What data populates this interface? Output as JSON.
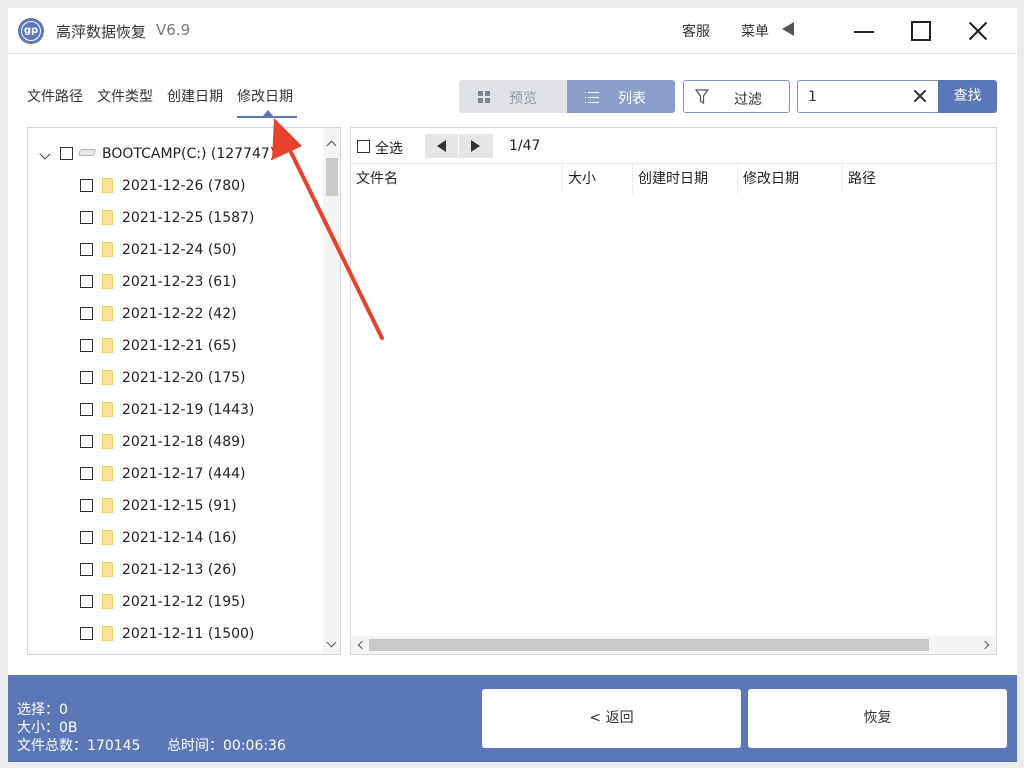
{
  "titlebar": {
    "app_name": "高萍数据恢复",
    "version": "V6.9",
    "logo_text": "gp",
    "service_label": "客服",
    "menu_label": "菜单"
  },
  "tabs": [
    "文件路径",
    "文件类型",
    "创建日期",
    "修改日期"
  ],
  "active_tab": "修改日期",
  "view_toggle": {
    "preview_label": "预览",
    "list_label": "列表",
    "selected": "列表"
  },
  "filter_label": "过滤",
  "search": {
    "value": "1",
    "button_label": "查找"
  },
  "tree": {
    "drive": {
      "label": "BOOTCAMP(C:)",
      "count": "(127747)"
    },
    "folders": [
      {
        "date": "2021-12-26",
        "count": "(780)"
      },
      {
        "date": "2021-12-25",
        "count": "(1587)"
      },
      {
        "date": "2021-12-24",
        "count": "(50)"
      },
      {
        "date": "2021-12-23",
        "count": "(61)"
      },
      {
        "date": "2021-12-22",
        "count": "(42)"
      },
      {
        "date": "2021-12-21",
        "count": "(65)"
      },
      {
        "date": "2021-12-20",
        "count": "(175)"
      },
      {
        "date": "2021-12-19",
        "count": "(1443)"
      },
      {
        "date": "2021-12-18",
        "count": "(489)"
      },
      {
        "date": "2021-12-17",
        "count": "(444)"
      },
      {
        "date": "2021-12-15",
        "count": "(91)"
      },
      {
        "date": "2021-12-14",
        "count": "(16)"
      },
      {
        "date": "2021-12-13",
        "count": "(26)"
      },
      {
        "date": "2021-12-12",
        "count": "(195)"
      },
      {
        "date": "2021-12-11",
        "count": "(1500)"
      }
    ]
  },
  "file_list": {
    "select_all_label": "全选",
    "page_indicator": "1/47",
    "columns": [
      "文件名",
      "大小",
      "创建时日期",
      "修改日期",
      "路径"
    ]
  },
  "footer": {
    "selected": "选择：0",
    "size": "大小：0B",
    "total_files": "文件总数：170145",
    "total_time": "总时间：00:06:36",
    "back_label": "< 返回",
    "recover_label": "恢复"
  },
  "colors": {
    "accent": "#5b77b7",
    "toggle_active": "#8b9ec9",
    "annotation": "#e8412c",
    "folder": "#ffe29a"
  }
}
